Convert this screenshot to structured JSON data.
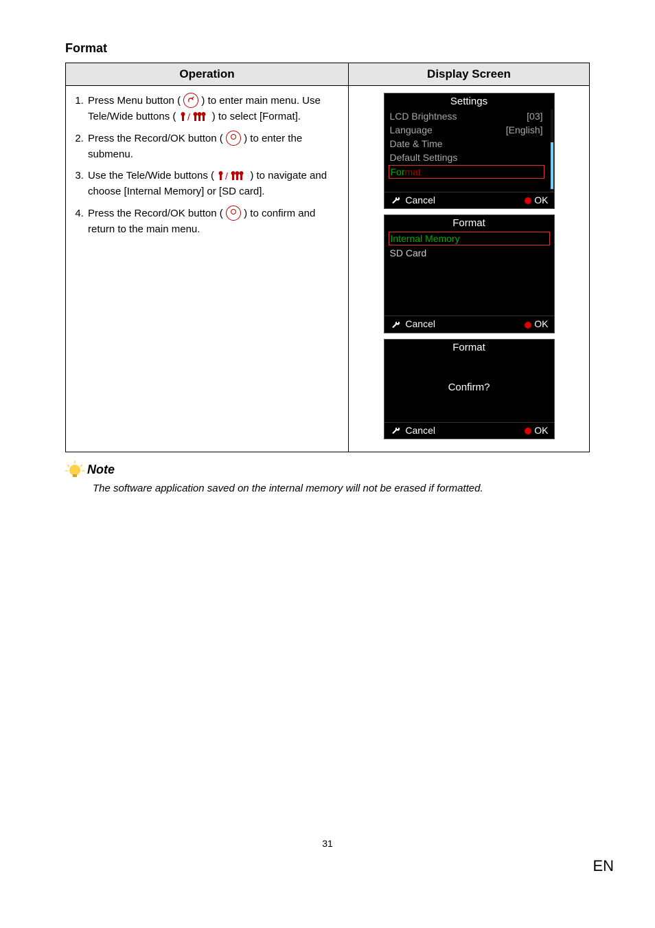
{
  "section_title": "Format",
  "table": {
    "header_operation": "Operation",
    "header_display": "Display Screen"
  },
  "steps": {
    "s1a": "Press Menu button (",
    "s1b": ") to enter main menu. Use Tele/Wide buttons (",
    "s1c": ") to select [Format].",
    "s2a": "Press the Record/OK button (",
    "s2b": ") to enter the submenu.",
    "s3a": "Use the Tele/Wide buttons (",
    "s3b": ") to navigate and choose [Internal Memory] or [SD card].",
    "s4a": "Press the Record/OK button (",
    "s4b": ") to confirm and return to the main menu."
  },
  "screen1": {
    "title": "Settings",
    "r1l": "LCD Brightness",
    "r1r": "[03]",
    "r2l": "Language",
    "r2r": "[English]",
    "r3": "Date & Time",
    "r4": "Default Settings",
    "r5l": "For",
    "r5r": "mat",
    "cancel": "Cancel",
    "ok": "OK"
  },
  "screen2": {
    "title": "Format",
    "r1": "Internal Memory",
    "r2": "SD Card",
    "cancel": "Cancel",
    "ok": "OK"
  },
  "screen3": {
    "title": "Format",
    "confirm": "Confirm?",
    "cancel": "Cancel",
    "ok": "OK"
  },
  "note_label": "Note",
  "note_text": "The software application saved on the internal memory will not be erased if formatted.",
  "page_number": "31",
  "lang": "EN"
}
